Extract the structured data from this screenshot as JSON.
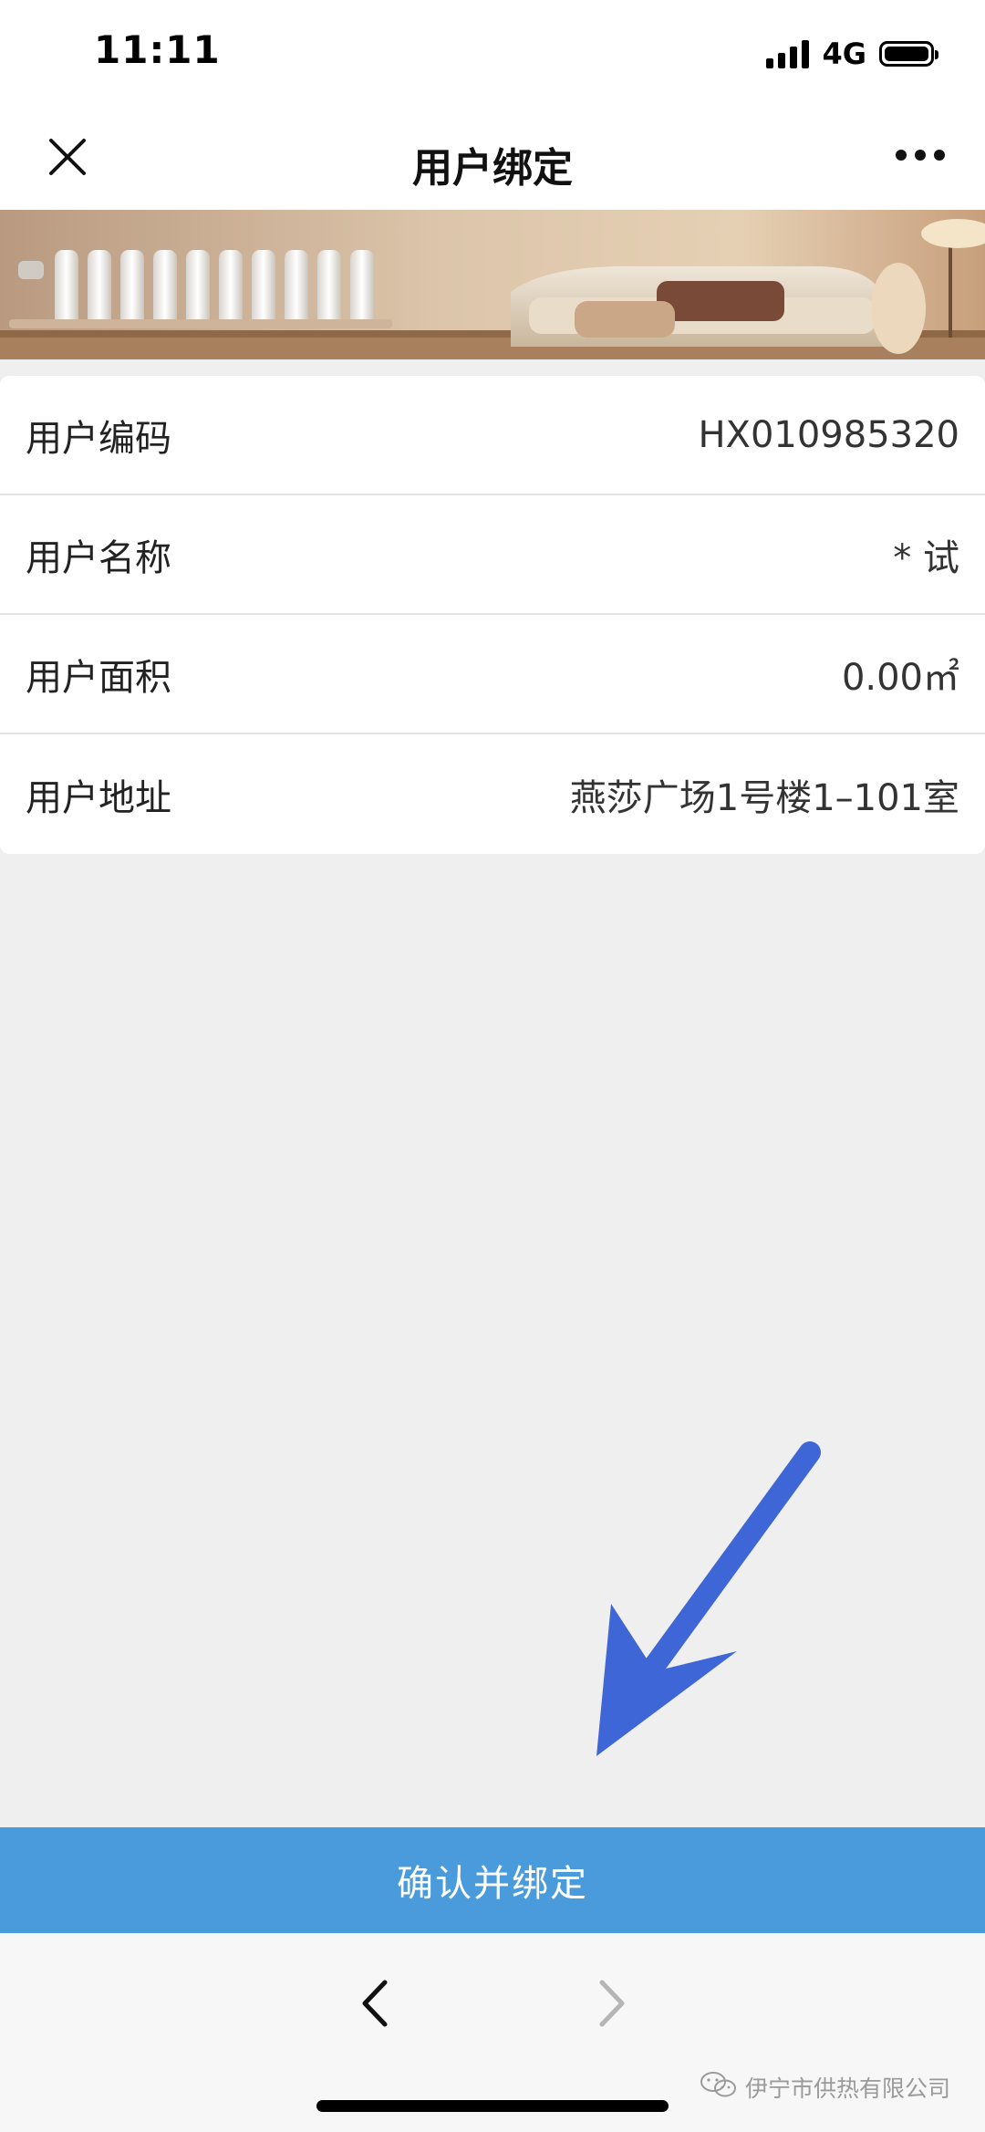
{
  "status_bar": {
    "time": "11:11",
    "network": "4G"
  },
  "nav": {
    "title": "用户绑定"
  },
  "user_info": {
    "rows": [
      {
        "label": "用户编码",
        "value": "HX010985320"
      },
      {
        "label": "用户名称",
        "value": "* 试"
      },
      {
        "label": "用户面积",
        "value": "0.00㎡"
      },
      {
        "label": "用户地址",
        "value": "燕莎广场1号楼1–101室"
      }
    ]
  },
  "confirm_button": {
    "label": "确认并绑定"
  },
  "watermark": {
    "text": "伊宁市供热有限公司"
  },
  "icons": {
    "close": "close-icon",
    "more": "more-icon",
    "back": "chevron-left-icon",
    "forward": "chevron-right-icon",
    "wechat": "wechat-icon"
  },
  "colors": {
    "accent": "#4a9bdb",
    "annotation_arrow": "#3f66d6",
    "background": "#efefef"
  }
}
